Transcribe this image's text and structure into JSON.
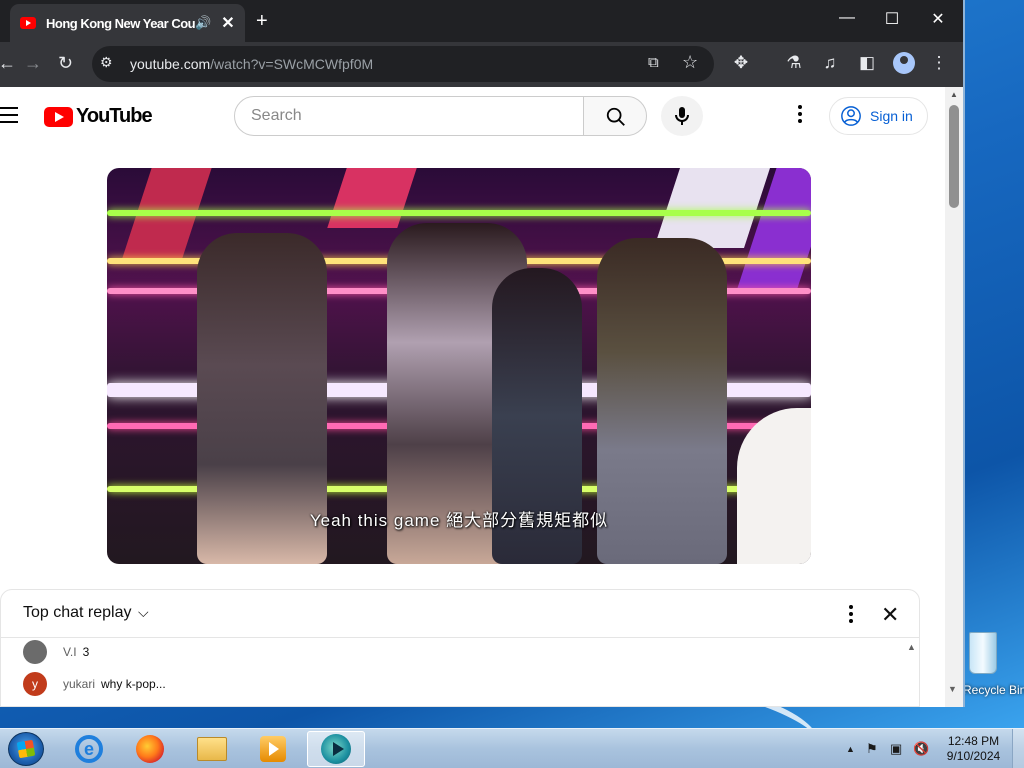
{
  "browser": {
    "tab": {
      "title": "Hong Kong New Year Countdown",
      "audio_icon": "🔊",
      "close": "✕"
    },
    "new_tab": "+",
    "window_controls": {
      "minimize": "—",
      "maximize": "☐",
      "close": "✕"
    },
    "nav": {
      "back": "←",
      "forward": "→",
      "reload": "↻"
    },
    "omnibox": {
      "url_main": "youtube.com",
      "url_path": "/watch?v=SWcMCWfpf0M"
    }
  },
  "youtube": {
    "logo_text": "YouTube",
    "search": {
      "placeholder": "Search"
    },
    "signin_label": "Sign in",
    "video": {
      "subtitle": "Yeah this game 絕大部分舊規矩都似"
    },
    "chat": {
      "title": "Top chat replay",
      "chevron": "⌵",
      "close": "✕",
      "messages": [
        {
          "author": "V.I",
          "text": "3",
          "avatar_letter": "",
          "avatar_color": "#6b6b6b"
        },
        {
          "author": "yukari",
          "text": "why k-pop...",
          "avatar_letter": "y",
          "avatar_color": "#c13b1b"
        }
      ]
    }
  },
  "desktop": {
    "recycle_bin_label": "Recycle Bin"
  },
  "taskbar": {
    "apps": [
      "internet-explorer",
      "firefox",
      "file-explorer",
      "media-player",
      "screen-capture"
    ],
    "clock": {
      "time": "12:48 PM",
      "date": "9/10/2024"
    }
  }
}
